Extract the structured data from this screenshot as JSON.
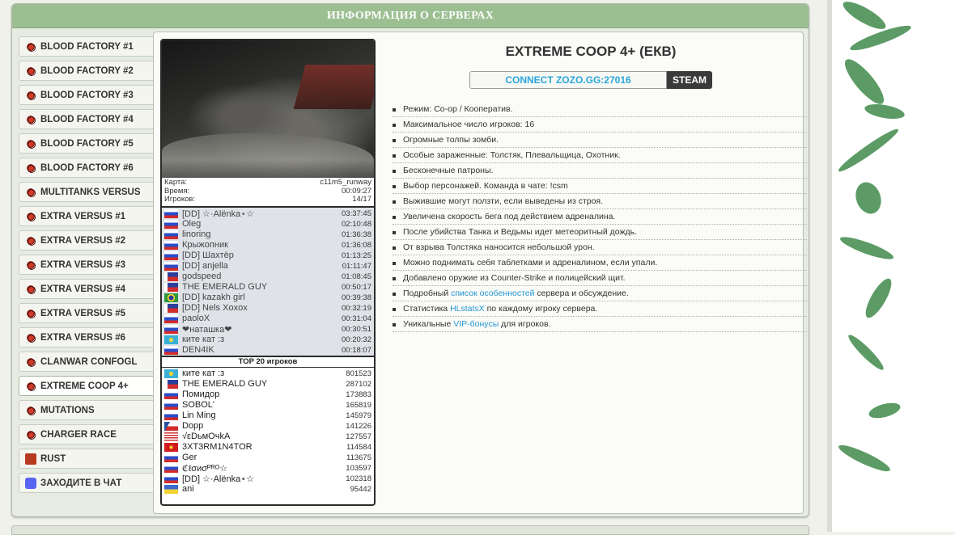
{
  "header": {
    "title": "ИНФОРМАЦИЯ О СЕРВЕРАХ"
  },
  "sidebar": {
    "items": [
      {
        "label": "BLOOD FACTORY #1",
        "icon": "hazard-icon"
      },
      {
        "label": "BLOOD FACTORY #2",
        "icon": "hazard-icon"
      },
      {
        "label": "BLOOD FACTORY #3",
        "icon": "hazard-icon"
      },
      {
        "label": "BLOOD FACTORY #4",
        "icon": "hazard-icon"
      },
      {
        "label": "BLOOD FACTORY #5",
        "icon": "hazard-icon"
      },
      {
        "label": "BLOOD FACTORY #6",
        "icon": "hazard-icon"
      },
      {
        "label": "MULTITANKS VERSUS",
        "icon": "hazard-icon"
      },
      {
        "label": "EXTRA VERSUS #1",
        "icon": "hazard-icon"
      },
      {
        "label": "EXTRA VERSUS #2",
        "icon": "hazard-icon"
      },
      {
        "label": "EXTRA VERSUS #3",
        "icon": "hazard-icon"
      },
      {
        "label": "EXTRA VERSUS #4",
        "icon": "hazard-icon"
      },
      {
        "label": "EXTRA VERSUS #5",
        "icon": "hazard-icon"
      },
      {
        "label": "EXTRA VERSUS #6",
        "icon": "hazard-icon"
      },
      {
        "label": "CLANWAR CONFOGL",
        "icon": "hazard-icon"
      },
      {
        "label": "EXTREME COOP 4+",
        "icon": "hazard-icon",
        "active": true
      },
      {
        "label": "MUTATIONS",
        "icon": "hazard-icon"
      },
      {
        "label": "CHARGER RACE",
        "icon": "hazard-icon"
      },
      {
        "label": "RUST",
        "icon": "rust-icon"
      },
      {
        "label": "ЗАХОДИТЕ В ЧАТ",
        "icon": "discord-icon"
      }
    ]
  },
  "server": {
    "title": "EXTREME COOP 4+ (ЕКВ)",
    "connect_label": "CONNECT ZOZO.GG:27016",
    "steam_label": "STEAM",
    "map_label": "Карта:",
    "map_value": "c11m5_runway",
    "time_label": "Время:",
    "time_value": "00:09:27",
    "players_label": "Игроков:",
    "players_value": "14/17"
  },
  "players": [
    {
      "flag": "ru",
      "name": "[DD] ☆·Alёnka⋆☆",
      "time": "03:37:45"
    },
    {
      "flag": "ru",
      "name": "Oleg",
      "time": "02:10:48"
    },
    {
      "flag": "ru",
      "name": "linoring",
      "time": "01:36:38"
    },
    {
      "flag": "ru",
      "name": "Крыжопник",
      "time": "01:36:08"
    },
    {
      "flag": "ru",
      "name": "[DD] Шахтёр",
      "time": "01:13:25"
    },
    {
      "flag": "ru",
      "name": "[DD] anjella",
      "time": "01:11:47"
    },
    {
      "flag": "ph",
      "name": "godspeed",
      "time": "01:08:45"
    },
    {
      "flag": "ph",
      "name": "THE EMERALD GUY",
      "time": "00:50:17"
    },
    {
      "flag": "br",
      "name": "[DD] kazakh girl",
      "time": "00:39:38"
    },
    {
      "flag": "ph",
      "name": "[DD] Nels Xoxox",
      "time": "00:32:19"
    },
    {
      "flag": "ru",
      "name": "paoloX",
      "time": "00:31:04"
    },
    {
      "flag": "ru",
      "name": "❤наташка❤",
      "time": "00:30:51"
    },
    {
      "flag": "kz",
      "name": "ките кат :з",
      "time": "00:20:32"
    },
    {
      "flag": "ru",
      "name": "DEN4IK",
      "time": "00:18:07"
    }
  ],
  "top_players": {
    "title": "TOP 20 игроков",
    "items": [
      {
        "flag": "kz",
        "name": "ките кат :з",
        "score": "801523"
      },
      {
        "flag": "ph",
        "name": "THE EMERALD GUY",
        "score": "287102"
      },
      {
        "flag": "ru",
        "name": "Помидор",
        "score": "173883"
      },
      {
        "flag": "ru",
        "name": "SOBOL'",
        "score": "165819"
      },
      {
        "flag": "ru",
        "name": "Lin Ming",
        "score": "145979"
      },
      {
        "flag": "cz",
        "name": "Dopp",
        "score": "141226"
      },
      {
        "flag": "us",
        "name": "√εDьмОчkA",
        "score": "127557"
      },
      {
        "flag": "mk",
        "name": "3XT3RM1N4TOR",
        "score": "114584"
      },
      {
        "flag": "ru",
        "name": "Ger",
        "score": "113675"
      },
      {
        "flag": "ru",
        "name": "ℭℓσиσᴾᴿᴼ☆",
        "score": "103597"
      },
      {
        "flag": "ru",
        "name": "[DD] ☆·Alёnka⋆☆",
        "score": "102318"
      },
      {
        "flag": "ua",
        "name": "ani",
        "score": "95442"
      }
    ]
  },
  "features": {
    "items": [
      "Режим: Co-op / Кооператив.",
      "Максимальное число игроков: 16",
      "Огромные толпы зомби.",
      "Особые зараженные: Толстяк, Плевальщица, Охотник.",
      "Бесконечные патроны.",
      "Выбор персонажей. Команда в чате: !csm",
      "Выжившие могут ползти, если выведены из строя.",
      "Увеличена скорость бега под действием адреналина.",
      "После убийства Танка и Ведьмы идет метеоритный дождь.",
      "От взрыва Толстяка наносится небольшой урон.",
      "Можно поднимать себя таблетками и адреналином, если упали.",
      "Добавлено оружие из Counter-Strike и полицейский щит."
    ],
    "details_prefix": "Подробный",
    "details_link": "список особенностей",
    "details_suffix": "сервера и обсуждение.",
    "stats_prefix": "Статистика",
    "stats_link": "HLstatsX",
    "stats_suffix": "по каждому игроку сервера.",
    "vip_prefix": "Уникальные",
    "vip_link": "VIP-бонусы",
    "vip_suffix": "для игроков."
  },
  "colors": {
    "title_bar": "#9cbf92",
    "link": "#2596d3",
    "connect_text": "#29a6dd"
  }
}
